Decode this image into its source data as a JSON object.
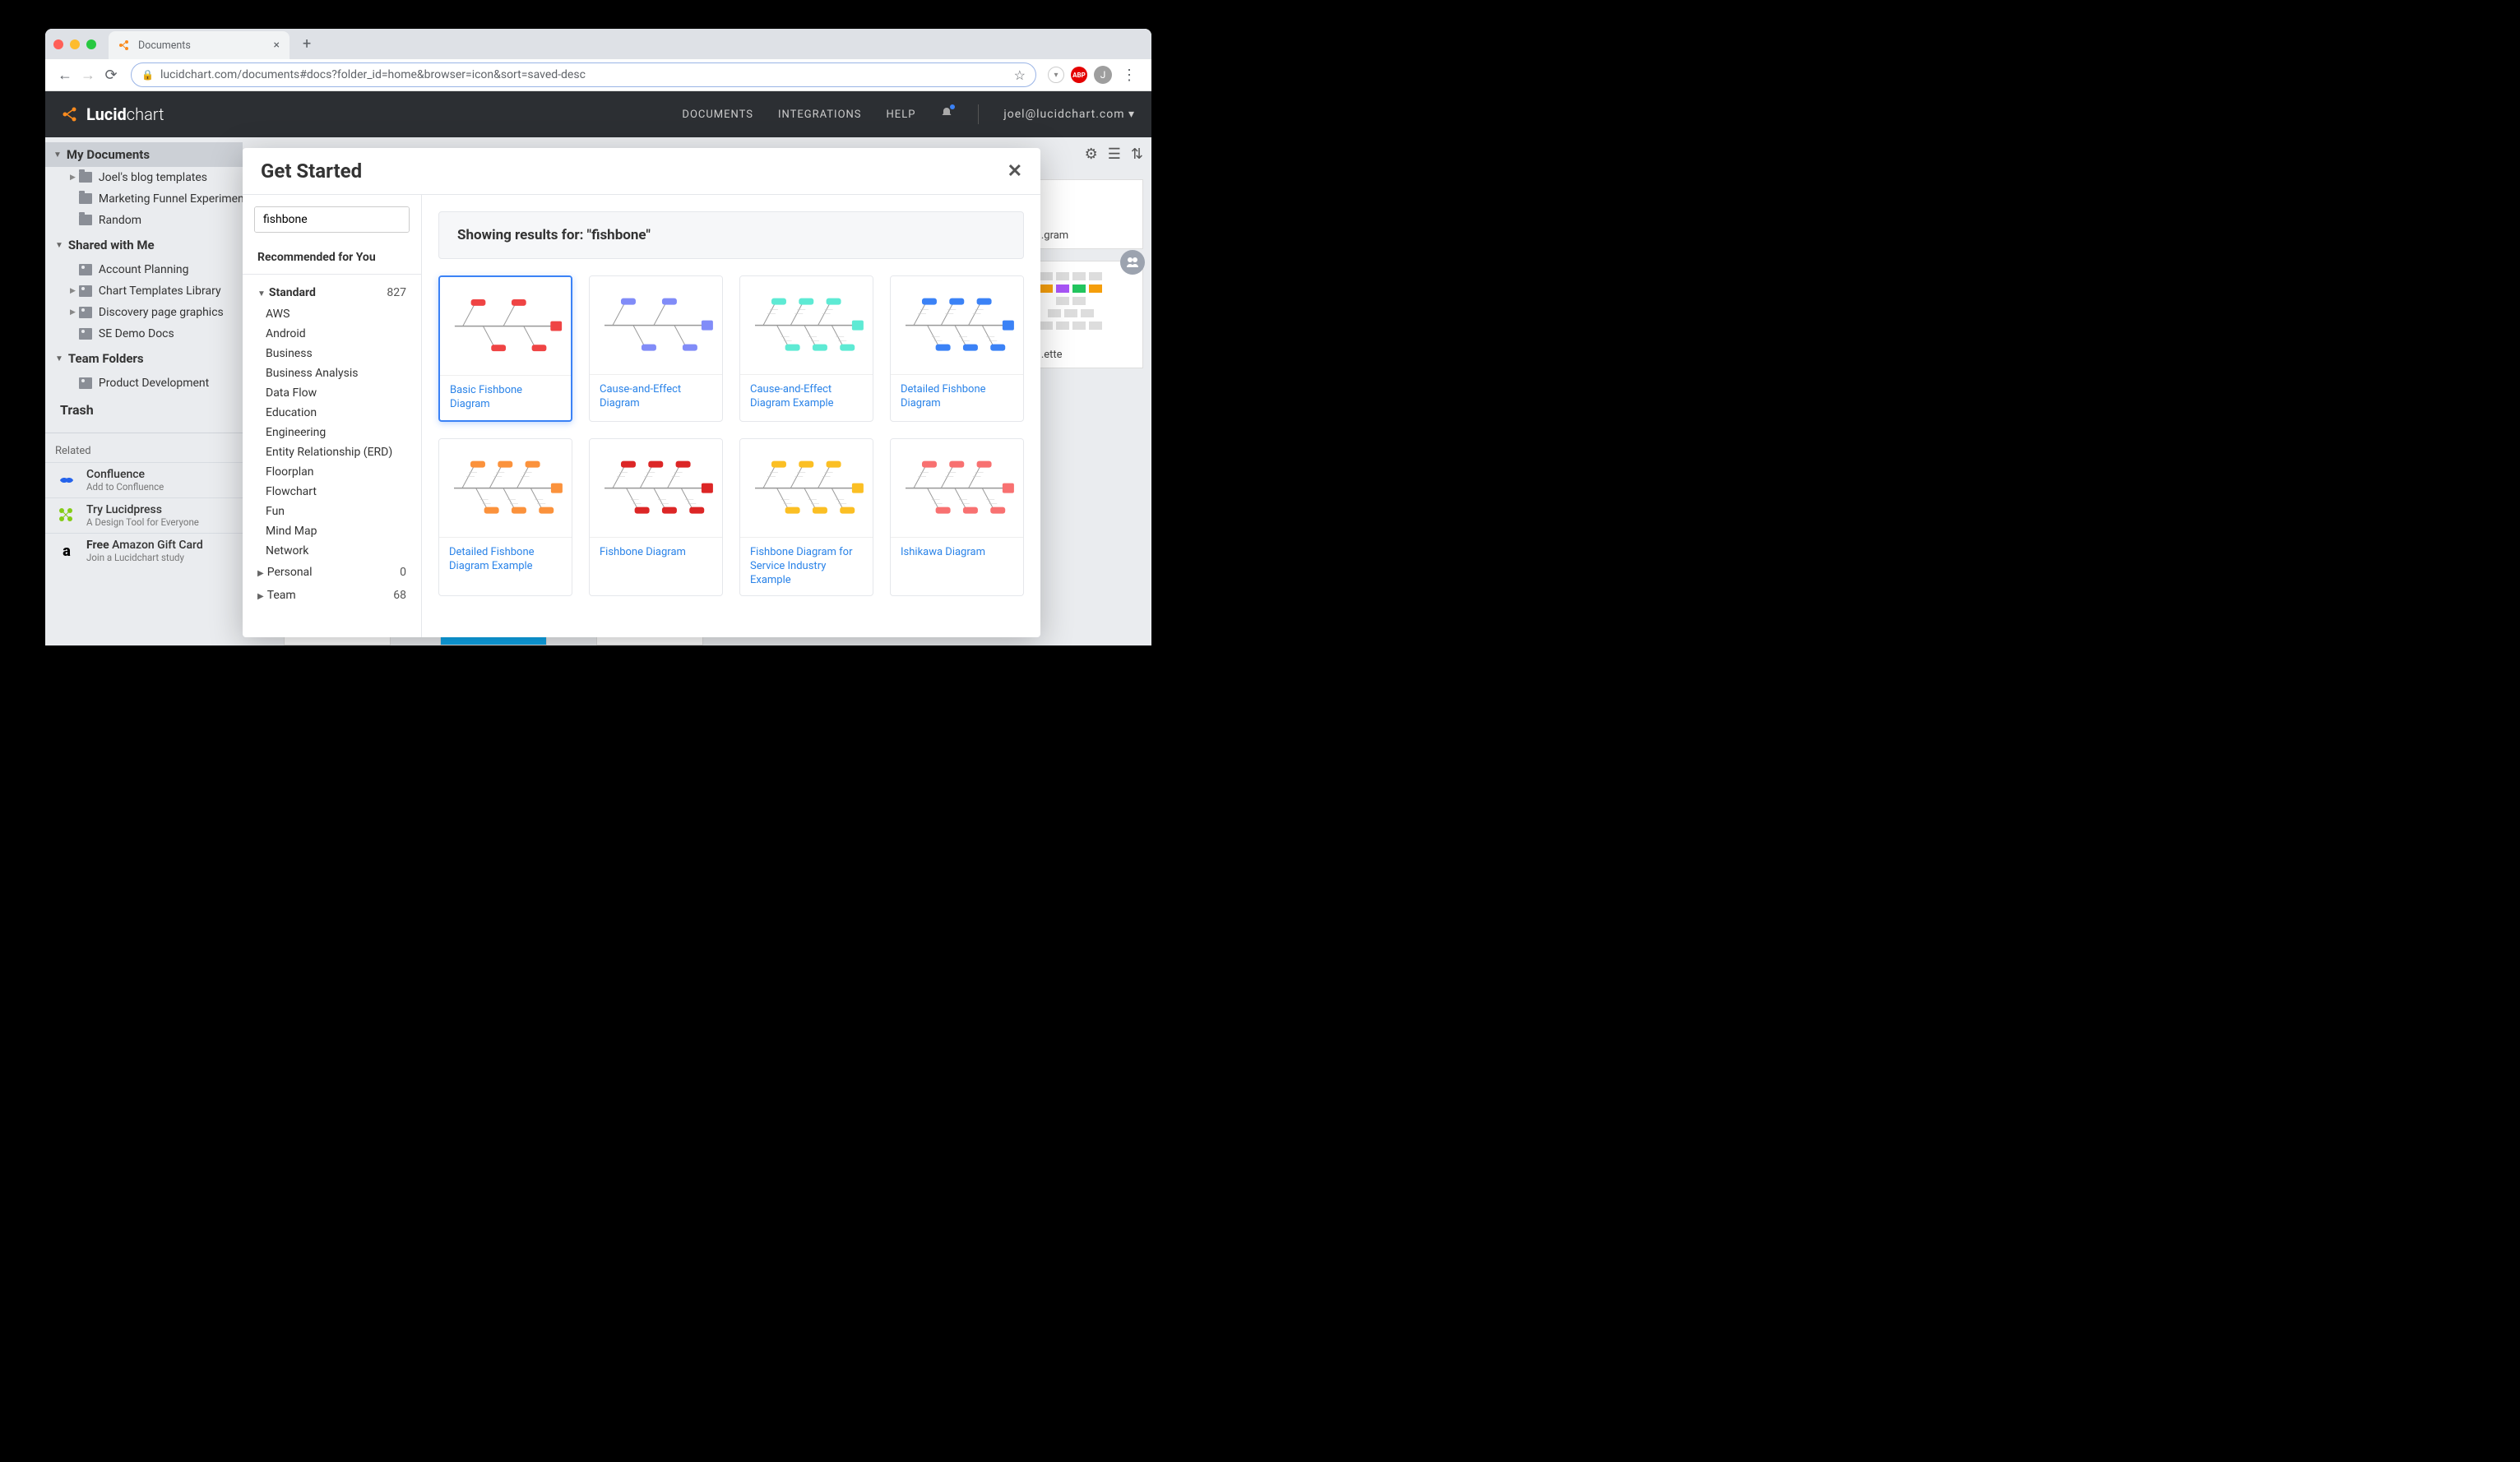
{
  "browser": {
    "tab_title": "Documents",
    "url": "lucidchart.com/documents#docs?folder_id=home&browser=icon&sort=saved-desc",
    "avatar_initial": "J"
  },
  "header": {
    "logo_bold": "Lucid",
    "logo_light": "chart",
    "nav": {
      "documents": "DOCUMENTS",
      "integrations": "INTEGRATIONS",
      "help": "HELP"
    },
    "user_email": "joel@lucidchart.com"
  },
  "sidebar": {
    "my_documents": "My Documents",
    "docs": [
      {
        "label": "Joel's blog templates",
        "expandable": true
      },
      {
        "label": "Marketing Funnel Experiments",
        "expandable": false
      },
      {
        "label": "Random",
        "expandable": false
      }
    ],
    "shared": "Shared with Me",
    "shared_items": [
      {
        "label": "Account Planning",
        "expandable": false
      },
      {
        "label": "Chart Templates Library",
        "expandable": true
      },
      {
        "label": "Discovery page graphics",
        "expandable": true
      },
      {
        "label": "SE Demo Docs",
        "expandable": false
      }
    ],
    "team": "Team Folders",
    "team_items": [
      {
        "label": "Product Development"
      }
    ],
    "trash": "Trash",
    "related_hdr": "Related",
    "related": [
      {
        "title": "Confluence",
        "sub": "Add to Confluence",
        "color": "#2563eb"
      },
      {
        "title": "Try Lucidpress",
        "sub": "A Design Tool for Everyone",
        "color": "#84cc16"
      },
      {
        "title_prefix": "Free",
        "title": " Amazon Gift Card",
        "sub": "Join a Lucidchart study",
        "color": "#000"
      }
    ]
  },
  "modal": {
    "title": "Get Started",
    "search_value": "fishbone",
    "recommended": "Recommended for You",
    "categories": [
      {
        "name": "Standard",
        "count": "827",
        "expanded": true,
        "children": [
          "AWS",
          "Android",
          "Business",
          "Business Analysis",
          "Data Flow",
          "Education",
          "Engineering",
          "Entity Relationship (ERD)",
          "Floorplan",
          "Flowchart",
          "Fun",
          "Mind Map",
          "Network"
        ]
      },
      {
        "name": "Personal",
        "count": "0",
        "expanded": false
      },
      {
        "name": "Team",
        "count": "68",
        "expanded": false
      }
    ],
    "results_prefix": "Showing results for: ",
    "results_query": "\"fishbone\"",
    "templates": [
      {
        "name": "Basic Fishbone Diagram",
        "color": "#ef4444",
        "selected": true
      },
      {
        "name": "Cause-and-Effect Diagram",
        "color": "#818cf8"
      },
      {
        "name": "Cause-and-Effect Diagram Example",
        "color": "#5eead4"
      },
      {
        "name": "Detailed Fishbone Diagram",
        "color": "#3b82f6"
      },
      {
        "name": "Detailed Fishbone Diagram Example",
        "color": "#fb923c"
      },
      {
        "name": "Fishbone Diagram",
        "color": "#dc2626"
      },
      {
        "name": "Fishbone Diagram for Service Industry Example",
        "color": "#fbbf24"
      },
      {
        "name": "Ishikawa Diagram",
        "color": "#f87171"
      }
    ]
  },
  "content_behind": {
    "card1": "...gram",
    "card2": "...ette"
  }
}
